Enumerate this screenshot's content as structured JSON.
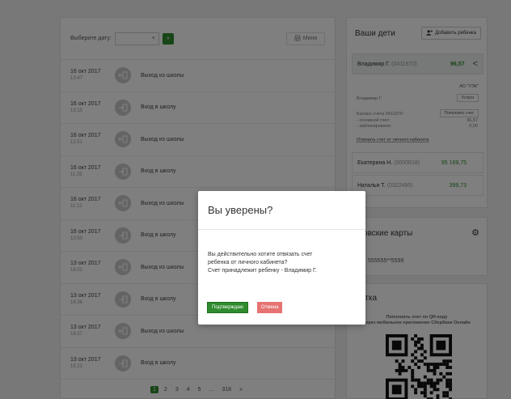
{
  "feed": {
    "date_label": "Выберите дату:",
    "date_value": "",
    "clear_symbol": "×",
    "go_symbol": "»",
    "print_label": "Мини",
    "events": [
      {
        "date": "16 окт 2017",
        "time": "13:47",
        "event": "Выход из школы",
        "kind": "exit"
      },
      {
        "date": "16 окт 2017",
        "time": "13:15",
        "event": "Вход в школу",
        "kind": "enter"
      },
      {
        "date": "16 окт 2017",
        "time": "12:51",
        "event": "Выход из школы",
        "kind": "exit"
      },
      {
        "date": "16 окт 2017",
        "time": "11:25",
        "event": "Вход в школу",
        "kind": "enter"
      },
      {
        "date": "16 окт 2017",
        "time": "11:12",
        "event": "Выход из школы",
        "kind": "exit"
      },
      {
        "date": "16 окт 2017",
        "time": "10:50",
        "event": "Вход в школу",
        "kind": "enter"
      },
      {
        "date": "13 окт 2017",
        "time": "18:02",
        "event": "Выход из школы",
        "kind": "exit"
      },
      {
        "date": "13 окт 2017",
        "time": "16:36",
        "event": "Вход в школу",
        "kind": "enter"
      },
      {
        "date": "13 окт 2017",
        "time": "16:27",
        "event": "Выход из школы",
        "kind": "exit"
      },
      {
        "date": "13 окт 2017",
        "time": "15:23",
        "event": "Вход в школу",
        "kind": "enter"
      }
    ],
    "pagination": [
      "1",
      "2",
      "3",
      "4",
      "5",
      "...",
      "318",
      "»"
    ],
    "active_page": "1"
  },
  "kids": {
    "title": "Ваши дети",
    "add_label": "Добавить ребенка",
    "selected": {
      "name": "Владимир Г.",
      "number": "(0411970)",
      "balance": "96,57",
      "chevron": "<"
    },
    "org": "АО \"УЭК\"",
    "detail_name": "Владимир Г.",
    "services_label": "Услуги",
    "balance_account_label": "Баланс счета 0411970:",
    "topup_label": "Пополнить счет",
    "main_account_label": "- основной счет:",
    "main_account_value": "96,57",
    "blocked_label": "- заблокировано:",
    "blocked_value": "0,00",
    "unlink_label": "Отвязать счет от личного кабинета",
    "others": [
      {
        "name": "Екатерина Н.",
        "number": "(0000018)",
        "balance": "95 169,75"
      },
      {
        "name": "Наталья Т.",
        "number": "(0322495)",
        "balance": "399,73"
      }
    ]
  },
  "cards": {
    "title": "нковские карты",
    "gear_icon": "gear-icon",
    "card_number": "555555**5599"
  },
  "memo": {
    "title": "мятка",
    "text_line1": "Пополнить счет по QR-коду",
    "text_line2": "через мобильное приложение Сбербанк Онлайн"
  },
  "modal": {
    "title": "Вы уверены?",
    "line1": "Вы действительно хотите отвязать счет",
    "line2": "ребенка от личного кабинета?",
    "line3": "Счет принадлежит ребенку - Владимир Г.",
    "confirm_label": "Подтверждаю",
    "cancel_label": "Отмена"
  },
  "colors": {
    "accent_green": "#2e8b2e",
    "cancel_red": "#e57373",
    "overlay": "rgba(0,0,0,0.5)"
  }
}
